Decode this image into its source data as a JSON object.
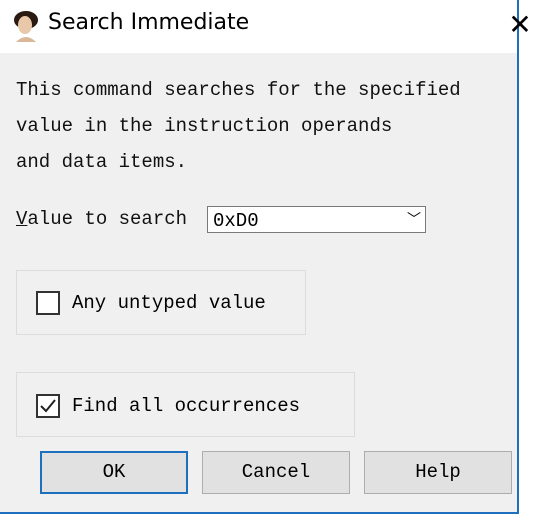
{
  "window": {
    "title": "Search Immediate",
    "close_icon": "close-icon",
    "app_icon": "portrait-icon"
  },
  "description": [
    "This command searches for the specified",
    "value in the instruction operands",
    "and data items."
  ],
  "value_label": "Value to search",
  "value": "0xD0",
  "any_untyped": {
    "label": "Any untyped value",
    "checked": false
  },
  "find_all": {
    "label": "Find all occurrences",
    "checked": true
  },
  "buttons": {
    "ok": "OK",
    "cancel": "Cancel",
    "help": "Help"
  },
  "colors": {
    "accent": "#1f6fbf"
  }
}
